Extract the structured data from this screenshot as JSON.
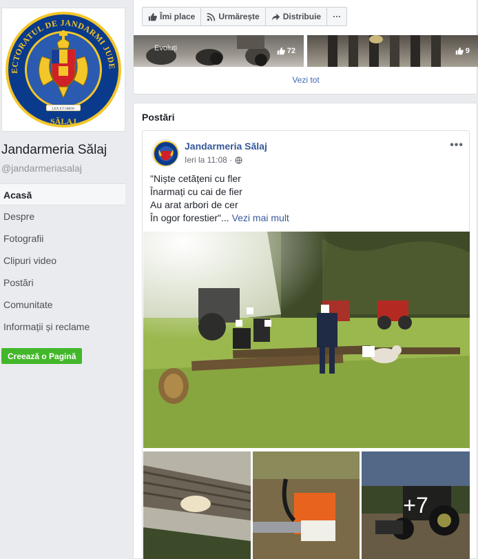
{
  "page": {
    "name": "Jandarmeria Sălaj",
    "handle": "@jandarmeriasalaj",
    "logo_ring_text": "INSPECTORATUL DE JANDARMI JUDEȚEAN",
    "logo_bottom_text": "SĂLAJ",
    "logo_motto": "LEX ET ORDO"
  },
  "nav": {
    "items": [
      {
        "label": "Acasă",
        "active": true
      },
      {
        "label": "Despre"
      },
      {
        "label": "Fotografii"
      },
      {
        "label": "Clipuri video"
      },
      {
        "label": "Postări"
      },
      {
        "label": "Comunitate"
      },
      {
        "label": "Informații și reclame"
      }
    ],
    "create_page": "Creează o Pagină"
  },
  "actions": {
    "like": "Îmi place",
    "follow": "Urmărește",
    "share": "Distribuie",
    "more": "···"
  },
  "photos_strip": {
    "label_left": "Evoluți",
    "likes_left": "72",
    "likes_right": "9",
    "see_all": "Vezi tot"
  },
  "posts": {
    "title": "Postări",
    "post": {
      "author": "Jandarmeria Sălaj",
      "time": "Ieri la 11:08 ·",
      "text_lines": [
        "\"Niște cetățeni cu fler",
        "Înarmați cu cai de fier",
        "Au arat arbori de cer",
        "În ogor forestier\"..."
      ],
      "see_more": "Vezi mai mult",
      "more_photos": "+7"
    }
  },
  "colors": {
    "background": "#e9ebee",
    "link": "#365899",
    "create_button": "#42b72a"
  }
}
